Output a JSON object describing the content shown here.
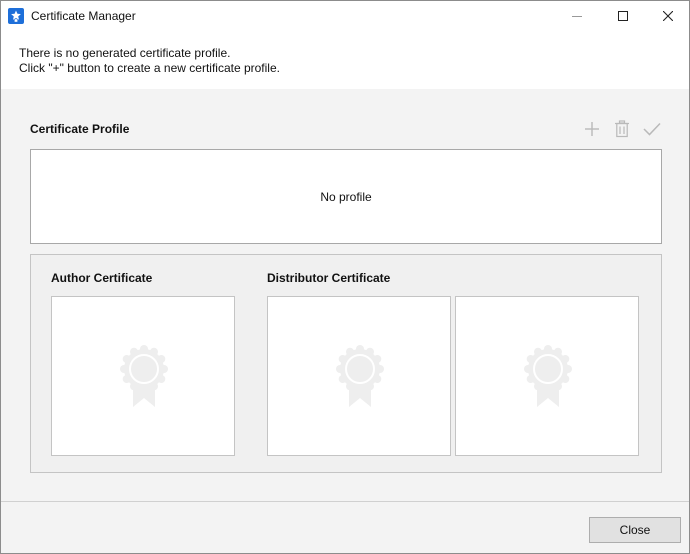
{
  "window": {
    "title": "Certificate Manager",
    "icon": "certificate-manager-app-icon"
  },
  "info": {
    "line1": "There is no generated certificate profile.",
    "line2": "Click \"+\" button to create a new certificate profile."
  },
  "profile": {
    "heading": "Certificate Profile",
    "empty_text": "No profile",
    "toolbar": {
      "add_icon": "plus-icon",
      "delete_icon": "trash-icon",
      "activate_icon": "check-icon"
    }
  },
  "certificates": {
    "author_heading": "Author Certificate",
    "distributor_heading": "Distributor Certificate",
    "placeholder_icon": "certificate-badge-icon"
  },
  "footer": {
    "close_label": "Close"
  },
  "colors": {
    "accent": "#1e6fd9",
    "disabled_icon": "#b9b9b9",
    "placeholder_badge": "#eeeeee"
  }
}
